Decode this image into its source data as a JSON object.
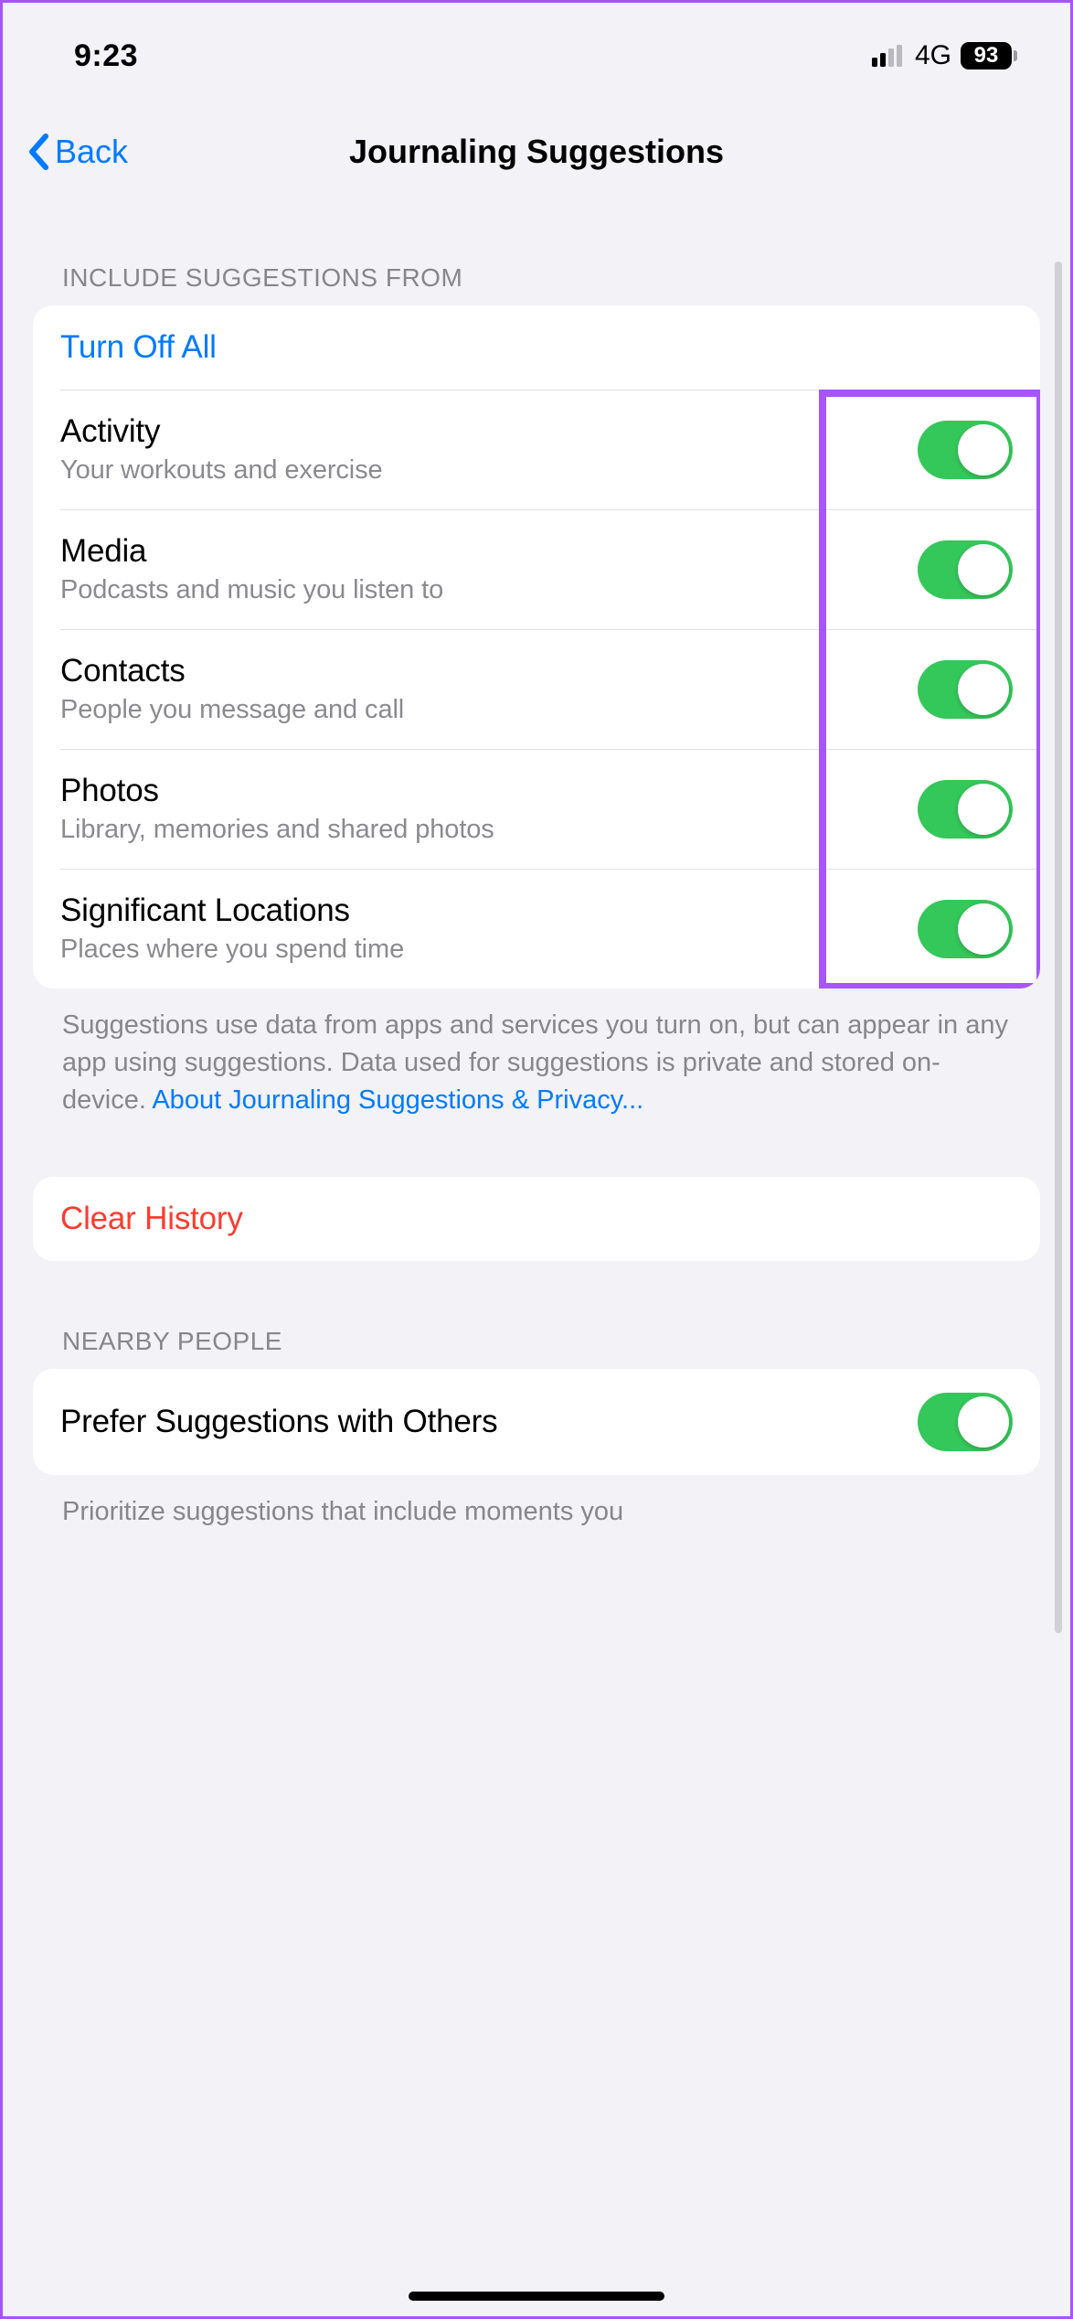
{
  "status": {
    "time": "9:23",
    "network": "4G",
    "battery": "93"
  },
  "nav": {
    "back": "Back",
    "title": "Journaling Suggestions"
  },
  "section1": {
    "header": "INCLUDE SUGGESTIONS FROM",
    "turn_off_all": "Turn Off All",
    "items": [
      {
        "title": "Activity",
        "subtitle": "Your workouts and exercise",
        "on": true
      },
      {
        "title": "Media",
        "subtitle": "Podcasts and music you listen to",
        "on": true
      },
      {
        "title": "Contacts",
        "subtitle": "People you message and call",
        "on": true
      },
      {
        "title": "Photos",
        "subtitle": "Library, memories and shared photos",
        "on": true
      },
      {
        "title": "Significant Locations",
        "subtitle": "Places where you spend time",
        "on": true
      }
    ],
    "footer_text": "Suggestions use data from apps and services you turn on, but can appear in any app using suggestions. Data used for suggestions is private and stored on-device. ",
    "footer_link": "About Journaling Suggestions & Privacy..."
  },
  "clear_history": "Clear History",
  "section2": {
    "header": "NEARBY PEOPLE",
    "prefer_title": "Prefer Suggestions with Others",
    "prefer_on": true,
    "footer_text": "Prioritize suggestions that include moments you"
  }
}
